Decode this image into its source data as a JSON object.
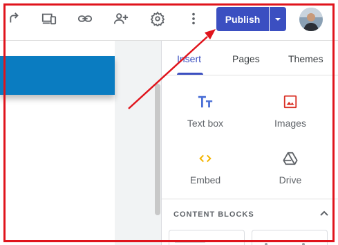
{
  "toolbar": {
    "icons": [
      "redo-icon",
      "device-preview-icon",
      "link-icon",
      "share-icon",
      "settings-icon",
      "more-vert-icon"
    ],
    "publish_label": "Publish",
    "accent": "#3b4fc1"
  },
  "panel": {
    "tabs": [
      {
        "label": "Insert",
        "active": true
      },
      {
        "label": "Pages",
        "active": false
      },
      {
        "label": "Themes",
        "active": false
      }
    ],
    "insert_items": [
      {
        "label": "Text box",
        "icon": "text-box-icon"
      },
      {
        "label": "Images",
        "icon": "image-icon"
      },
      {
        "label": "Embed",
        "icon": "embed-icon"
      },
      {
        "label": "Drive",
        "icon": "drive-icon"
      }
    ],
    "content_blocks_title": "CONTENT BLOCKS"
  },
  "annotation": {
    "color": "#e0141c"
  }
}
